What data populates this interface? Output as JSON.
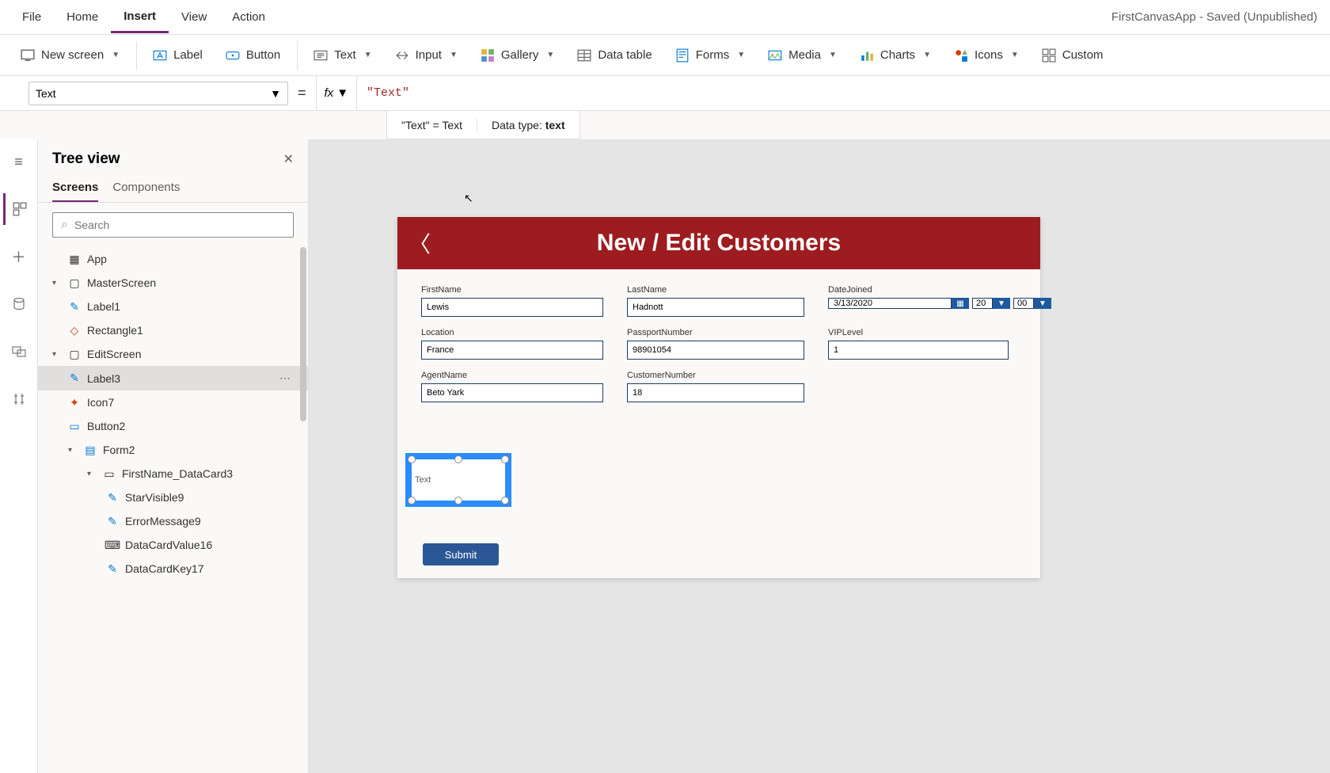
{
  "app_status": "FirstCanvasApp - Saved (Unpublished)",
  "menu": {
    "file": "File",
    "home": "Home",
    "insert": "Insert",
    "view": "View",
    "action": "Action"
  },
  "toolbar": {
    "new_screen": "New screen",
    "label": "Label",
    "button": "Button",
    "text": "Text",
    "input": "Input",
    "gallery": "Gallery",
    "data_table": "Data table",
    "forms": "Forms",
    "media": "Media",
    "charts": "Charts",
    "icons": "Icons",
    "custom": "Custom"
  },
  "formula": {
    "property": "Text",
    "fx": "fx",
    "value": "\"Text\"",
    "hint_expr": "\"Text\"  =  Text",
    "hint_type_label": "Data type: ",
    "hint_type": "text"
  },
  "tree": {
    "title": "Tree view",
    "tab_screens": "Screens",
    "tab_components": "Components",
    "search_placeholder": "Search",
    "app": "App",
    "master_screen": "MasterScreen",
    "label1": "Label1",
    "rectangle1": "Rectangle1",
    "edit_screen": "EditScreen",
    "label3": "Label3",
    "icon7": "Icon7",
    "button2": "Button2",
    "form2": "Form2",
    "firstname_dc": "FirstName_DataCard3",
    "starvisible": "StarVisible9",
    "errormessage": "ErrorMessage9",
    "datacardvalue": "DataCardValue16",
    "datacardkey": "DataCardKey17"
  },
  "screen": {
    "title": "New / Edit Customers",
    "fields": {
      "firstname_l": "FirstName",
      "firstname_v": "Lewis",
      "lastname_l": "LastName",
      "lastname_v": "Hadnott",
      "datejoined_l": "DateJoined",
      "datejoined_v": "3/13/2020",
      "dj_h": "20",
      "dj_m": "00",
      "location_l": "Location",
      "location_v": "France",
      "passport_l": "PassportNumber",
      "passport_v": "98901054",
      "vip_l": "VIPLevel",
      "vip_v": "1",
      "agent_l": "AgentName",
      "agent_v": "Beto Yark",
      "custnum_l": "CustomerNumber",
      "custnum_v": "18"
    },
    "selected_label_text": "Text",
    "submit": "Submit"
  }
}
